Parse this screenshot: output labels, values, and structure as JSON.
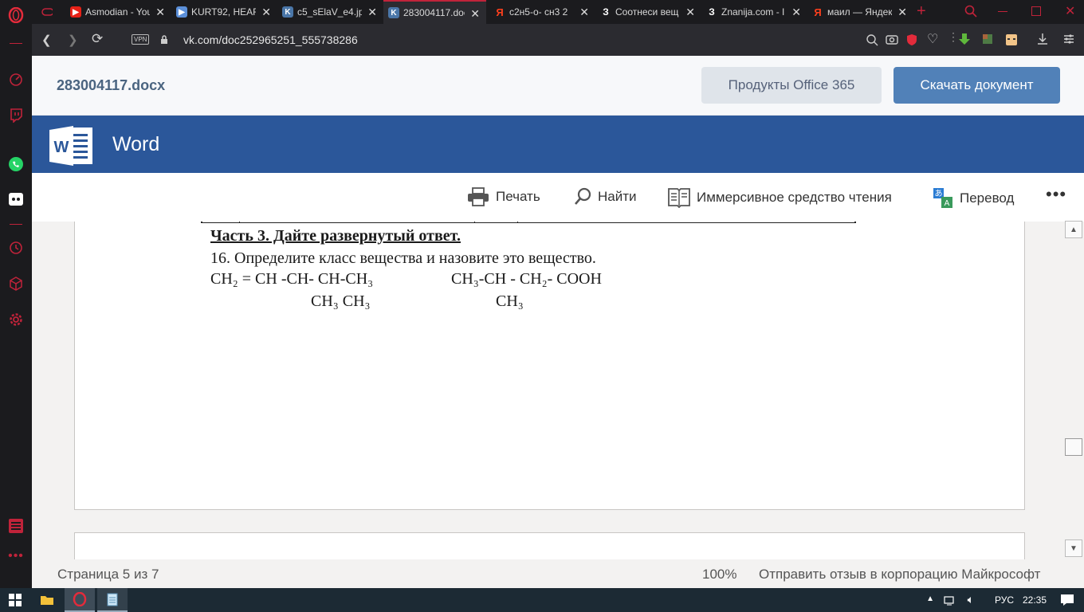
{
  "browser": {
    "tabs": [
      {
        "label": "",
        "icon": "gamepad-icon",
        "color": "#c0233a"
      },
      {
        "label": "Asmodian - You",
        "icon": "youtube-icon",
        "color": "#e62117"
      },
      {
        "label": "KURT92, HEAR",
        "icon": "video-icon",
        "color": "#5b8fd9"
      },
      {
        "label": "c5_sElaV_e4.jpg",
        "icon": "vk-icon",
        "color": "#4a76a8"
      },
      {
        "label": "283004117.doc",
        "icon": "vk-icon",
        "color": "#4a76a8"
      },
      {
        "label": "c2н5-о- сн3 2",
        "icon": "yandex-icon",
        "color": "#fc3f1d"
      },
      {
        "label": "Соотнеси вещ",
        "icon": "znanija-icon",
        "color": "#1a1a1a"
      },
      {
        "label": "Znanija.com - I",
        "icon": "znanija-icon",
        "color": "#1a1a1a"
      },
      {
        "label": "маил — Яндек",
        "icon": "yandex-icon",
        "color": "#fc3f1d"
      }
    ],
    "url": "vk.com/doc252965251_555738286",
    "vpn_label": "VPN"
  },
  "vk": {
    "doc_title": "283004117.docx",
    "office_button": "Продукты Office 365",
    "download_button": "Скачать документ"
  },
  "word": {
    "app_name": "Word",
    "commands": {
      "print": "Печать",
      "find": "Найти",
      "immersive": "Иммерсивное средство чтения",
      "translate": "Перевод"
    }
  },
  "document": {
    "heading": "Часть 3. Дайте развернутый ответ.",
    "question": "16. Определите класс вещества и назовите это вещество.",
    "formula1": {
      "main": "CH₂ = CH -CH- CH-CH₃",
      "sub": "CH₃ CH₃"
    },
    "formula2": {
      "main": "CH₃-CH - CH₂- COOH",
      "sub": "CH₃"
    }
  },
  "status": {
    "page": "Страница 5 из 7",
    "zoom": "100%",
    "feedback": "Отправить отзыв в корпорацию Майкрософт"
  },
  "taskbar": {
    "language": "РУС",
    "time": "22:35"
  },
  "colors": {
    "word_blue": "#2b579a",
    "vk_blue": "#5181b8",
    "opera_red": "#c0233a"
  }
}
